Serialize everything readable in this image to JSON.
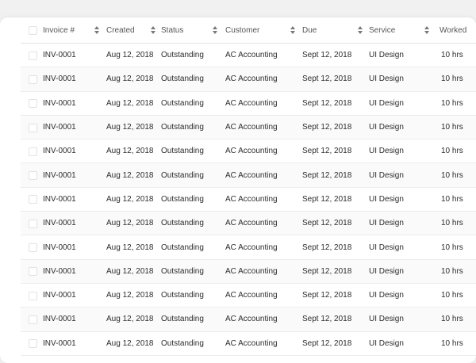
{
  "table": {
    "columns": {
      "invoice": "Invoice #",
      "created": "Created",
      "status": "Status",
      "customer": "Customer",
      "due": "Due",
      "service": "Service",
      "worked": "Worked"
    },
    "rows": [
      {
        "invoice": "INV-0001",
        "created": "Aug 12, 2018",
        "status": "Outstanding",
        "customer": "AC Accounting",
        "due": "Sept 12, 2018",
        "service": "UI Design",
        "worked": "10 hrs"
      },
      {
        "invoice": "INV-0001",
        "created": "Aug 12, 2018",
        "status": "Outstanding",
        "customer": "AC Accounting",
        "due": "Sept 12, 2018",
        "service": "UI Design",
        "worked": "10 hrs"
      },
      {
        "invoice": "INV-0001",
        "created": "Aug 12, 2018",
        "status": "Outstanding",
        "customer": "AC Accounting",
        "due": "Sept 12, 2018",
        "service": "UI Design",
        "worked": "10 hrs"
      },
      {
        "invoice": "INV-0001",
        "created": "Aug 12, 2018",
        "status": "Outstanding",
        "customer": "AC Accounting",
        "due": "Sept 12, 2018",
        "service": "UI Design",
        "worked": "10 hrs"
      },
      {
        "invoice": "INV-0001",
        "created": "Aug 12, 2018",
        "status": "Outstanding",
        "customer": "AC Accounting",
        "due": "Sept 12, 2018",
        "service": "UI Design",
        "worked": "10 hrs"
      },
      {
        "invoice": "INV-0001",
        "created": "Aug 12, 2018",
        "status": "Outstanding",
        "customer": "AC Accounting",
        "due": "Sept 12, 2018",
        "service": "UI Design",
        "worked": "10 hrs"
      },
      {
        "invoice": "INV-0001",
        "created": "Aug 12, 2018",
        "status": "Outstanding",
        "customer": "AC Accounting",
        "due": "Sept 12, 2018",
        "service": "UI Design",
        "worked": "10 hrs"
      },
      {
        "invoice": "INV-0001",
        "created": "Aug 12, 2018",
        "status": "Outstanding",
        "customer": "AC Accounting",
        "due": "Sept 12, 2018",
        "service": "UI Design",
        "worked": "10 hrs"
      },
      {
        "invoice": "INV-0001",
        "created": "Aug 12, 2018",
        "status": "Outstanding",
        "customer": "AC Accounting",
        "due": "Sept 12, 2018",
        "service": "UI Design",
        "worked": "10 hrs"
      },
      {
        "invoice": "INV-0001",
        "created": "Aug 12, 2018",
        "status": "Outstanding",
        "customer": "AC Accounting",
        "due": "Sept 12, 2018",
        "service": "UI Design",
        "worked": "10 hrs"
      },
      {
        "invoice": "INV-0001",
        "created": "Aug 12, 2018",
        "status": "Outstanding",
        "customer": "AC Accounting",
        "due": "Sept 12, 2018",
        "service": "UI Design",
        "worked": "10 hrs"
      },
      {
        "invoice": "INV-0001",
        "created": "Aug 12, 2018",
        "status": "Outstanding",
        "customer": "AC Accounting",
        "due": "Sept 12, 2018",
        "service": "UI Design",
        "worked": "10 hrs"
      },
      {
        "invoice": "INV-0001",
        "created": "Aug 12, 2018",
        "status": "Outstanding",
        "customer": "AC Accounting",
        "due": "Sept 12, 2018",
        "service": "UI Design",
        "worked": "10 hrs"
      }
    ]
  },
  "icons": {
    "sort": "sort-icon",
    "checkbox": "checkbox-icon"
  },
  "colors": {
    "page_background": "#f1f1f1",
    "card_background": "#ffffff",
    "row_alt": "#fafafa",
    "text": "#2c2c2c",
    "header_text": "#555555",
    "divider": "#ececec"
  }
}
